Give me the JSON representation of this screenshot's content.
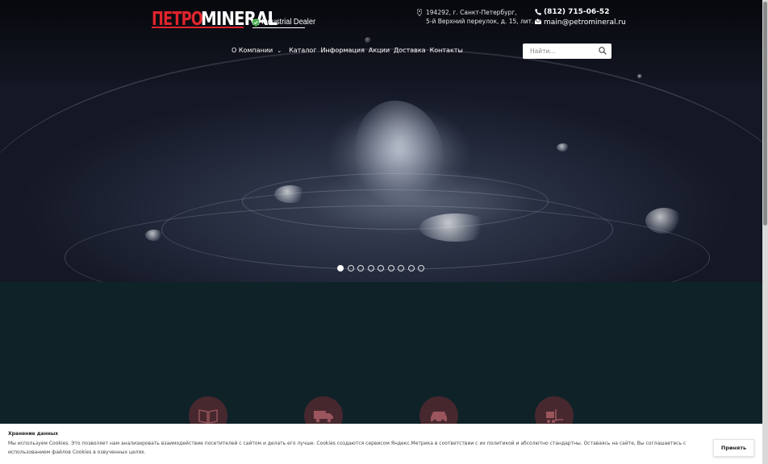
{
  "header": {
    "logo_red": "ПЕТРО",
    "logo_white": "MINERAL",
    "dealer_badge": "Industrial Dealer",
    "address_line1": "194292, г. Санкт-Петербург,",
    "address_line2": "5-й Верхний переулок, д. 15, лит. А",
    "phone": "(812) 715-06-52",
    "email": "main@petromineral.ru"
  },
  "nav": {
    "items": [
      {
        "label": "О Компании"
      },
      {
        "label": "Каталог"
      },
      {
        "label": "Информация"
      },
      {
        "label": "Акции"
      },
      {
        "label": "Доставка"
      },
      {
        "label": "Контакты"
      }
    ]
  },
  "search": {
    "placeholder": "Найти..."
  },
  "slider": {
    "total_slides": 9,
    "active_slide": 1
  },
  "features": {
    "icons": [
      "book-icon",
      "truck-icon",
      "car-icon",
      "forklift-icon"
    ]
  },
  "cookie": {
    "title": "Хранение данных",
    "text": "Мы используем Cookies. Это позволяет нам анализировать взаимодействие посетителей с сайтом и делать его лучше. Cookies создаются сервисом Яндекс.Метрика в соответствии с их политикой и абсолютно стандартны. Оставаясь на сайте, Вы соглашаетесь с использованием файлов Cookies в озвученных целях.",
    "accept_label": "Принять"
  },
  "colors": {
    "brand_red": "#e0242c",
    "dark_bg": "#0f2228",
    "dealer_green": "#4caf50"
  }
}
